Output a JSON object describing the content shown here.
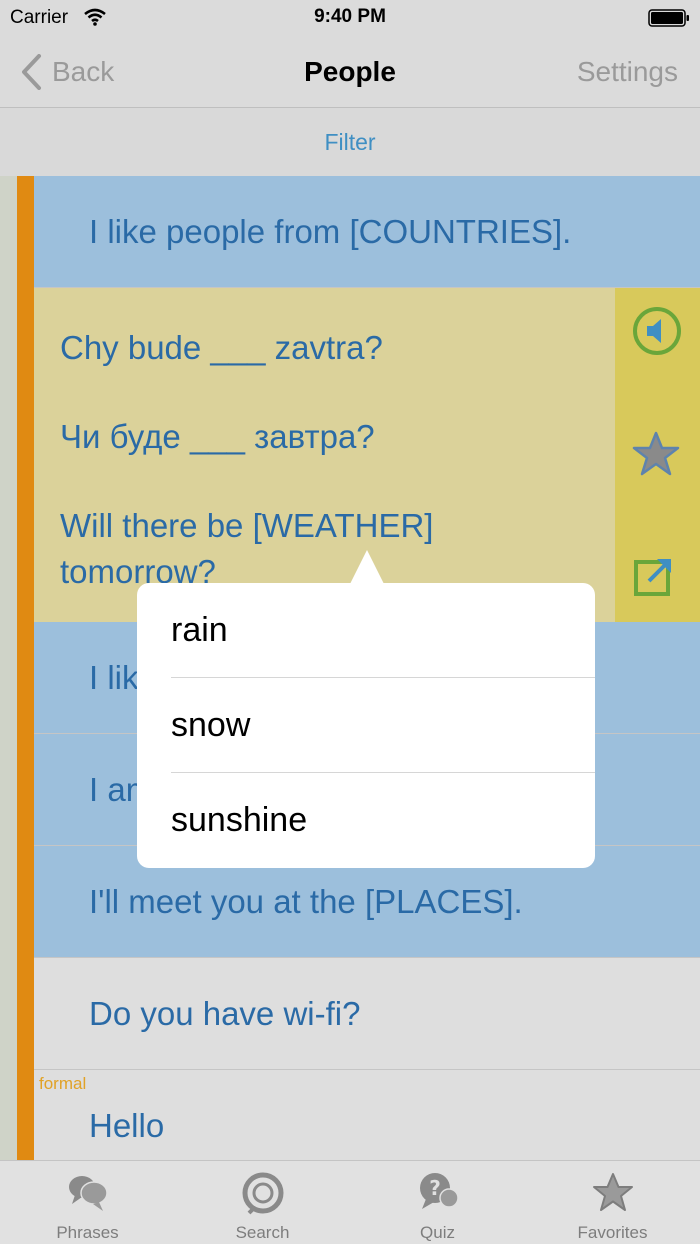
{
  "status": {
    "carrier": "Carrier",
    "time": "9:40 PM"
  },
  "nav": {
    "back_label": "Back",
    "title": "People",
    "settings_label": "Settings"
  },
  "filter": {
    "label": "Filter"
  },
  "rows": {
    "r0": {
      "text": "I like people from [COUNTRIES]."
    },
    "expanded": {
      "line1": "Chy bude ___ zavtra?",
      "line2": "Чи буде ___ завтра?",
      "line3a": "Will there be [WEATHER]",
      "line3b": "tomorrow?"
    },
    "r2": {
      "text": "I like"
    },
    "r3": {
      "text": "I am"
    },
    "r4": {
      "text": "I'll meet you at the [PLACES]."
    },
    "r5": {
      "text": "Do you have wi-fi?"
    },
    "r6": {
      "tag": "formal",
      "text": "Hello"
    }
  },
  "popover": {
    "options": [
      "rain",
      "snow",
      "sunshine"
    ]
  },
  "tabs": [
    {
      "label": "Phrases",
      "icon": "speech-bubbles-icon"
    },
    {
      "label": "Search",
      "icon": "search-icon"
    },
    {
      "label": "Quiz",
      "icon": "question-bubble-icon"
    },
    {
      "label": "Favorites",
      "icon": "star-icon"
    }
  ],
  "colors": {
    "accent_blue": "#2a6aa6",
    "row_blue": "#9cbfdc",
    "row_expanded": "#dbd29a",
    "action_column": "#d8c95b",
    "orange_bar": "#e08a12",
    "speaker_green": "#6aa63a"
  }
}
